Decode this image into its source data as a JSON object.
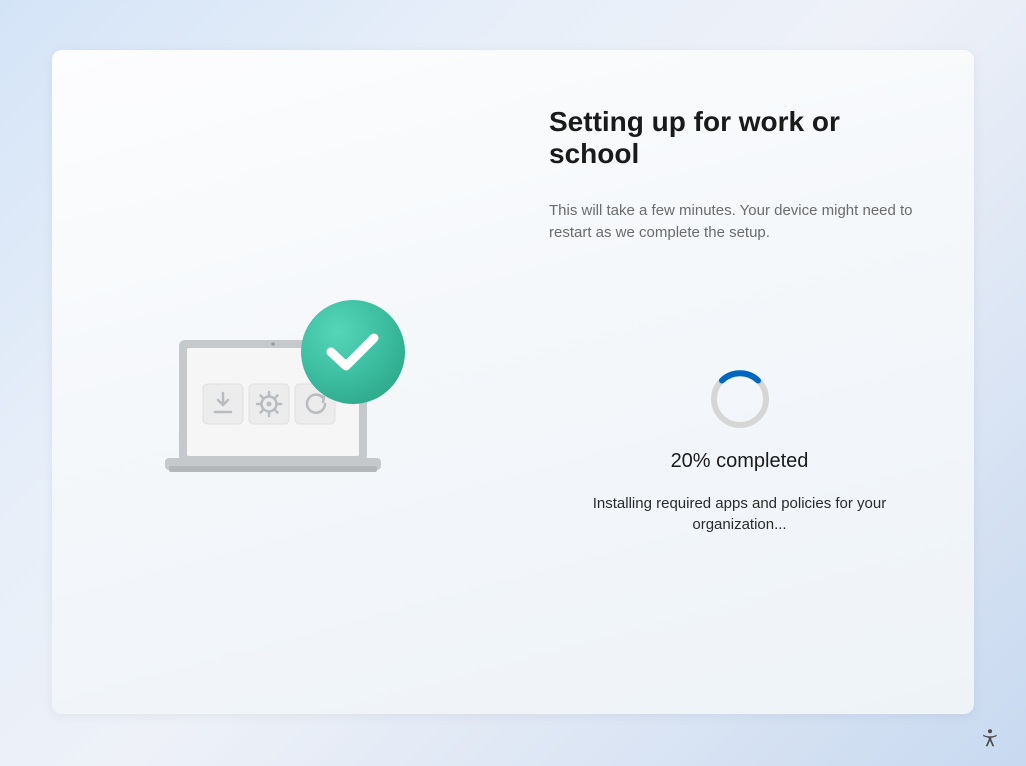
{
  "header": {
    "title": "Setting up for work or school",
    "subtitle": "This will take a few minutes. Your device might need to restart as we complete the setup."
  },
  "progress": {
    "percent": 20,
    "label": "20% completed",
    "status": "Installing required apps and policies for your organization..."
  },
  "colors": {
    "accent_blue": "#0067c0",
    "checkmark_green": "#3dbea0"
  },
  "illustration": {
    "name": "laptop-setup-success",
    "icons": [
      "download",
      "gear",
      "refresh",
      "checkmark-badge"
    ]
  },
  "accessibility": {
    "label": "Accessibility"
  }
}
